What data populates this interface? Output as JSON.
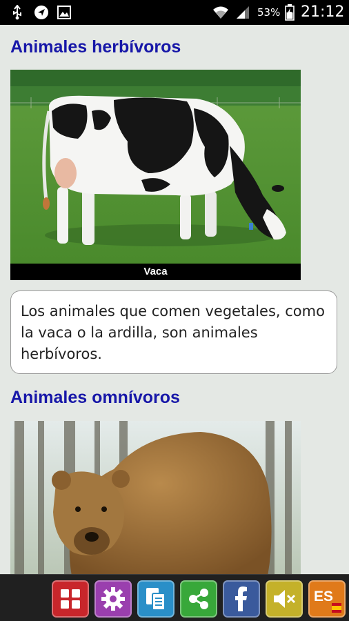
{
  "status_bar": {
    "battery_percent": "53%",
    "time": "21:12",
    "icons": [
      "usb-icon",
      "navigation-icon",
      "image-icon",
      "wifi-icon",
      "signal-icon",
      "battery-icon"
    ]
  },
  "sections": [
    {
      "heading": "Animales herbívoros",
      "image_caption": "Vaca",
      "description": "Los animales que comen vegetales, como la vaca o la ardilla, son animales herbívoros."
    },
    {
      "heading": "Animales omnívoros"
    }
  ],
  "toolbar": {
    "buttons": [
      {
        "name": "menu-grid-button",
        "icon": "grid-icon",
        "color": "#c8262b"
      },
      {
        "name": "settings-button",
        "icon": "gear-icon",
        "color": "#9a3fae"
      },
      {
        "name": "copy-button",
        "icon": "copy-icon",
        "color": "#2a8fc8"
      },
      {
        "name": "share-button",
        "icon": "share-icon",
        "color": "#38a83a"
      },
      {
        "name": "facebook-button",
        "icon": "facebook-icon",
        "color": "#3a5a9c"
      },
      {
        "name": "mute-button",
        "icon": "speaker-mute-icon",
        "color": "#c4b12a"
      },
      {
        "name": "language-button",
        "icon": "spain-flag-icon",
        "label": "ES",
        "color": "#e07a1a"
      }
    ]
  }
}
